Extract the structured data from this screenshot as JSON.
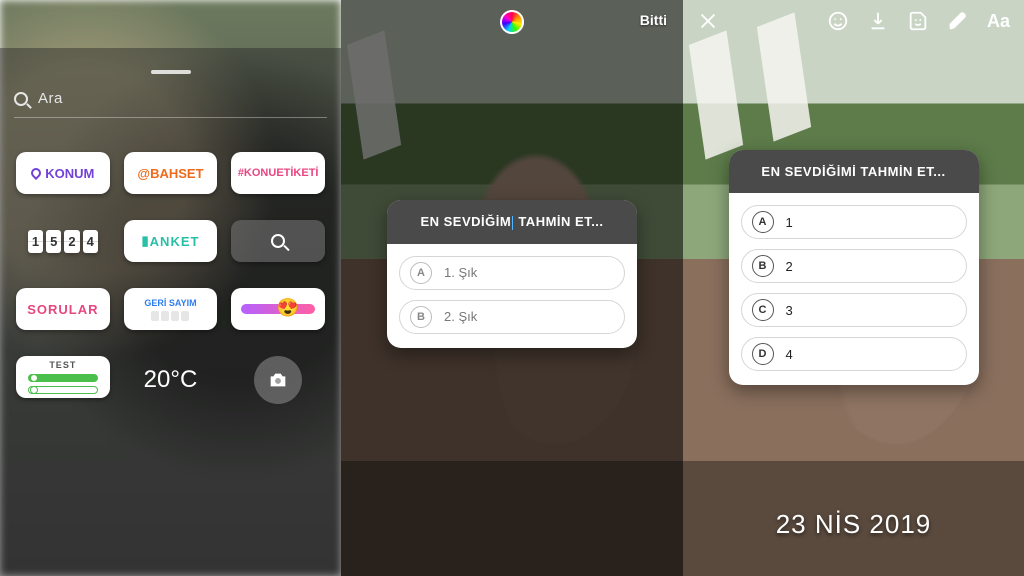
{
  "panel1": {
    "search_placeholder": "Ara",
    "stickers": {
      "konum": "KONUM",
      "bahset": "@BAHSET",
      "hashtag": "#KONUETİKETİ",
      "clock_digits": [
        "1",
        "5",
        "2",
        "4"
      ],
      "anket": "ANKET",
      "sorular": "SORULAR",
      "geri_sayim": "GERİ SAYIM",
      "test": "TEST",
      "temperature": "20°C"
    }
  },
  "panel2": {
    "done_label": "Bitti",
    "quiz_prompt_before": "EN SEVDİĞİM",
    "quiz_prompt_after": " TAHMİN ET...",
    "options": [
      {
        "letter": "A",
        "text": "1. Şık"
      },
      {
        "letter": "B",
        "text": "2. Şık"
      }
    ]
  },
  "panel3": {
    "text_tool": "Aa",
    "quiz_prompt": "EN SEVDİĞİMİ TAHMİN ET...",
    "options": [
      {
        "letter": "A",
        "text": "1"
      },
      {
        "letter": "B",
        "text": "2"
      },
      {
        "letter": "C",
        "text": "3"
      },
      {
        "letter": "D",
        "text": "4"
      }
    ],
    "date_text": "23 NİS 2019"
  }
}
